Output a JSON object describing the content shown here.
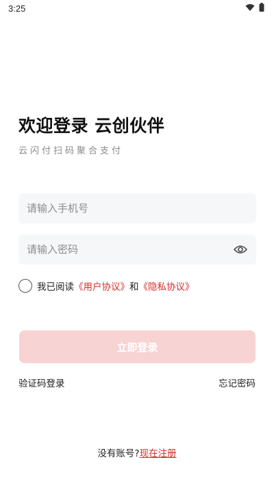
{
  "status_bar": {
    "time": "3:25"
  },
  "header": {
    "title": "欢迎登录 云创伙伴",
    "subtitle": "云闪付扫码聚合支付"
  },
  "form": {
    "phone_placeholder": "请输入手机号",
    "password_placeholder": "请输入密码"
  },
  "agreement": {
    "prefix": "我已阅读",
    "user_agreement": "《用户协议》",
    "and": "和",
    "privacy_policy": "《隐私协议》"
  },
  "actions": {
    "login_label": "立即登录",
    "sms_login": "验证码登录",
    "forgot_password": "忘记密码"
  },
  "footer": {
    "no_account": "没有账号?",
    "register_now": "现在注册"
  },
  "colors": {
    "accent": "#d62b2b",
    "button_disabled": "#f8d3d3",
    "field_bg": "#f6f7f9"
  }
}
